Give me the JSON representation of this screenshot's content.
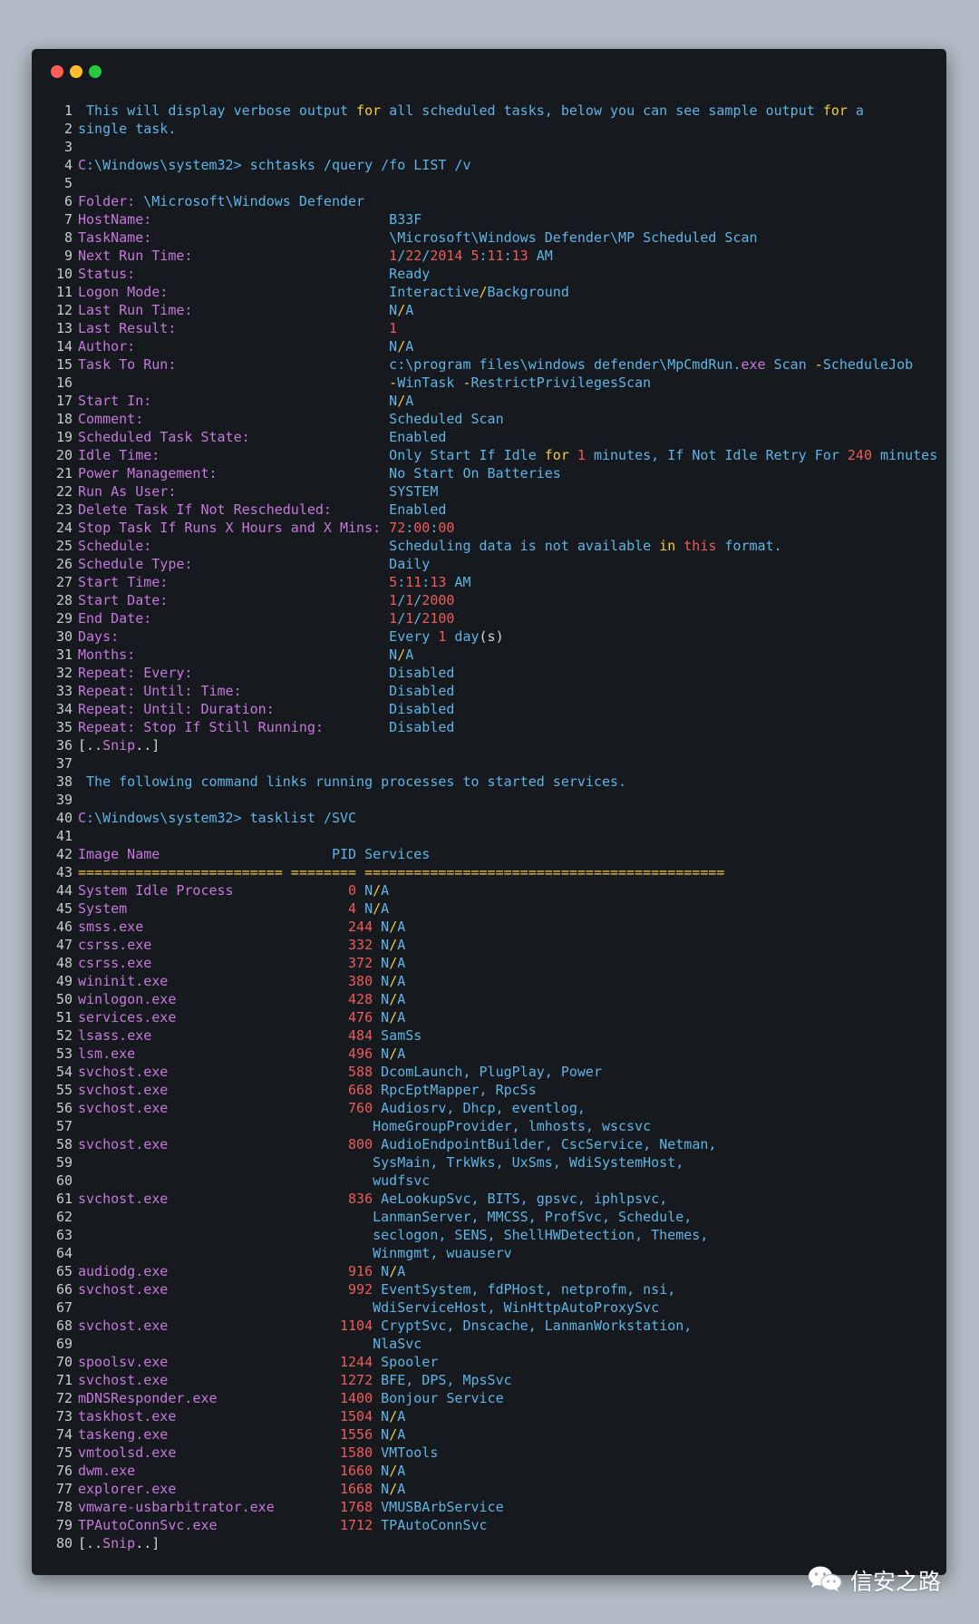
{
  "window": {
    "controls": [
      "close",
      "minimize",
      "maximize"
    ]
  },
  "colors": {
    "cyan": "#5fb4e6",
    "magenta": "#c678dd",
    "red": "#ef5b5b",
    "yellow": "#f7ca3b",
    "white": "#d3d6da",
    "orange": "#e8a33d",
    "background": "#16191d"
  },
  "lines": [
    [
      [
        " This will display verbose output ",
        "cy"
      ],
      [
        "for",
        "yl"
      ],
      [
        " all scheduled tasks, below you can see sample output ",
        "cy"
      ],
      [
        "for",
        "yl"
      ],
      [
        " a",
        "cy"
      ]
    ],
    [
      [
        "single task.",
        "cy"
      ]
    ],
    [],
    [
      [
        "C",
        "mg"
      ],
      [
        ":\\Windows\\system32> schtasks /query /fo LIST /v",
        "cy"
      ]
    ],
    [],
    [
      [
        "Folder: ",
        "mg"
      ],
      [
        "\\Microsoft\\Windows Defender",
        "cy"
      ]
    ],
    [
      [
        "HostName:                             ",
        "mg"
      ],
      [
        "B33F",
        "cy"
      ]
    ],
    [
      [
        "TaskName:                             ",
        "mg"
      ],
      [
        "\\Microsoft\\Windows Defender\\MP Scheduled Scan",
        "cy"
      ]
    ],
    [
      [
        "Next Run Time:                        ",
        "mg"
      ],
      [
        "1",
        "rd"
      ],
      [
        "/",
        "cy"
      ],
      [
        "22",
        "rd"
      ],
      [
        "/",
        "cy"
      ],
      [
        "2014",
        "rd"
      ],
      [
        " ",
        "cy"
      ],
      [
        "5",
        "rd"
      ],
      [
        ":",
        "cy"
      ],
      [
        "11",
        "rd"
      ],
      [
        ":",
        "cy"
      ],
      [
        "13",
        "rd"
      ],
      [
        " AM",
        "cy"
      ]
    ],
    [
      [
        "Status:                               ",
        "mg"
      ],
      [
        "Ready",
        "cy"
      ]
    ],
    [
      [
        "Logon Mode:                           ",
        "mg"
      ],
      [
        "Interactive",
        "cy"
      ],
      [
        "/",
        "yl"
      ],
      [
        "Background",
        "cy"
      ]
    ],
    [
      [
        "Last Run Time:                        ",
        "mg"
      ],
      [
        "N",
        "cy"
      ],
      [
        "/",
        "yl"
      ],
      [
        "A",
        "cy"
      ]
    ],
    [
      [
        "Last Result:                          ",
        "mg"
      ],
      [
        "1",
        "rd"
      ]
    ],
    [
      [
        "Author:                               ",
        "mg"
      ],
      [
        "N",
        "cy"
      ],
      [
        "/",
        "yl"
      ],
      [
        "A",
        "cy"
      ]
    ],
    [
      [
        "Task To Run:                          ",
        "mg"
      ],
      [
        "c:\\program files\\windows defender\\MpCmdRun.",
        "cy"
      ],
      [
        "exe",
        "mg"
      ],
      [
        " Scan ",
        "cy"
      ],
      [
        "-",
        "yl"
      ],
      [
        "ScheduleJob",
        "cy"
      ]
    ],
    [
      [
        "                                      ",
        "mg"
      ],
      [
        "-",
        "yl"
      ],
      [
        "WinTask ",
        "cy"
      ],
      [
        "-",
        "yl"
      ],
      [
        "RestrictPrivilegesScan",
        "cy"
      ]
    ],
    [
      [
        "Start In:                             ",
        "mg"
      ],
      [
        "N",
        "cy"
      ],
      [
        "/",
        "yl"
      ],
      [
        "A",
        "cy"
      ]
    ],
    [
      [
        "Comment:                              ",
        "mg"
      ],
      [
        "Scheduled Scan",
        "cy"
      ]
    ],
    [
      [
        "Scheduled Task State:                 ",
        "mg"
      ],
      [
        "Enabled",
        "cy"
      ]
    ],
    [
      [
        "Idle Time:                            ",
        "mg"
      ],
      [
        "Only Start If Idle ",
        "cy"
      ],
      [
        "for",
        "yl"
      ],
      [
        " ",
        "cy"
      ],
      [
        "1",
        "rd"
      ],
      [
        " minutes, If Not Idle Retry For ",
        "cy"
      ],
      [
        "240",
        "rd"
      ],
      [
        " minutes",
        "cy"
      ]
    ],
    [
      [
        "Power Management:                     ",
        "mg"
      ],
      [
        "No Start On Batteries",
        "cy"
      ]
    ],
    [
      [
        "Run As User:                          ",
        "mg"
      ],
      [
        "SYSTEM",
        "cy"
      ]
    ],
    [
      [
        "Delete Task If Not Rescheduled:       ",
        "mg"
      ],
      [
        "Enabled",
        "cy"
      ]
    ],
    [
      [
        "Stop Task If Runs X Hours and X Mins: ",
        "mg"
      ],
      [
        "72",
        "rd"
      ],
      [
        ":",
        "cy"
      ],
      [
        "00",
        "rd"
      ],
      [
        ":",
        "cy"
      ],
      [
        "00",
        "rd"
      ]
    ],
    [
      [
        "Schedule:                             ",
        "mg"
      ],
      [
        "Scheduling data is not available ",
        "cy"
      ],
      [
        "in",
        "yl"
      ],
      [
        " ",
        "cy"
      ],
      [
        "this",
        "rd"
      ],
      [
        " format.",
        "cy"
      ]
    ],
    [
      [
        "Schedule Type:                        ",
        "mg"
      ],
      [
        "Daily",
        "cy"
      ]
    ],
    [
      [
        "Start Time:                           ",
        "mg"
      ],
      [
        "5",
        "rd"
      ],
      [
        ":",
        "cy"
      ],
      [
        "11",
        "rd"
      ],
      [
        ":",
        "cy"
      ],
      [
        "13",
        "rd"
      ],
      [
        " AM",
        "cy"
      ]
    ],
    [
      [
        "Start Date:                           ",
        "mg"
      ],
      [
        "1",
        "rd"
      ],
      [
        "/",
        "cy"
      ],
      [
        "1",
        "rd"
      ],
      [
        "/",
        "cy"
      ],
      [
        "2000",
        "rd"
      ]
    ],
    [
      [
        "End Date:                             ",
        "mg"
      ],
      [
        "1",
        "rd"
      ],
      [
        "/",
        "cy"
      ],
      [
        "1",
        "rd"
      ],
      [
        "/",
        "cy"
      ],
      [
        "2100",
        "rd"
      ]
    ],
    [
      [
        "Days:                                 ",
        "mg"
      ],
      [
        "Every ",
        "cy"
      ],
      [
        "1",
        "rd"
      ],
      [
        " day",
        "cy"
      ],
      [
        "(s)",
        "wt"
      ]
    ],
    [
      [
        "Months:                               ",
        "mg"
      ],
      [
        "N",
        "cy"
      ],
      [
        "/",
        "yl"
      ],
      [
        "A",
        "cy"
      ]
    ],
    [
      [
        "Repeat: Every:                        ",
        "mg"
      ],
      [
        "Disabled",
        "cy"
      ]
    ],
    [
      [
        "Repeat: Until: Time:                  ",
        "mg"
      ],
      [
        "Disabled",
        "cy"
      ]
    ],
    [
      [
        "Repeat: Until: Duration:              ",
        "mg"
      ],
      [
        "Disabled",
        "cy"
      ]
    ],
    [
      [
        "Repeat: Stop If Still Running:        ",
        "mg"
      ],
      [
        "Disabled",
        "cy"
      ]
    ],
    [
      [
        "[..",
        "wt"
      ],
      [
        "Snip",
        "mg"
      ],
      [
        "..]",
        "wt"
      ]
    ],
    [],
    [
      [
        " The following command links running processes to started services.",
        "cy"
      ]
    ],
    [],
    [
      [
        "C",
        "mg"
      ],
      [
        ":\\Windows\\system32> tasklist /SVC",
        "cy"
      ]
    ],
    [],
    [
      [
        "Image Name                     ",
        "mg"
      ],
      [
        "PID Services",
        "cy"
      ]
    ],
    [
      [
        "========================= ======== ============================================",
        "yl"
      ]
    ],
    [
      [
        "System Idle Process              ",
        "mg"
      ],
      [
        "0",
        "rd"
      ],
      [
        " N",
        "cy"
      ],
      [
        "/",
        "yl"
      ],
      [
        "A",
        "cy"
      ]
    ],
    [
      [
        "System                           ",
        "mg"
      ],
      [
        "4",
        "rd"
      ],
      [
        " N",
        "cy"
      ],
      [
        "/",
        "yl"
      ],
      [
        "A",
        "cy"
      ]
    ],
    [
      [
        "smss.",
        "mg"
      ],
      [
        "exe",
        "mg"
      ],
      [
        "                         ",
        "mg"
      ],
      [
        "244",
        "rd"
      ],
      [
        " N",
        "cy"
      ],
      [
        "/",
        "yl"
      ],
      [
        "A",
        "cy"
      ]
    ],
    [
      [
        "csrss.",
        "mg"
      ],
      [
        "exe",
        "mg"
      ],
      [
        "                        ",
        "mg"
      ],
      [
        "332",
        "rd"
      ],
      [
        " N",
        "cy"
      ],
      [
        "/",
        "yl"
      ],
      [
        "A",
        "cy"
      ]
    ],
    [
      [
        "csrss.",
        "mg"
      ],
      [
        "exe",
        "mg"
      ],
      [
        "                        ",
        "mg"
      ],
      [
        "372",
        "rd"
      ],
      [
        " N",
        "cy"
      ],
      [
        "/",
        "yl"
      ],
      [
        "A",
        "cy"
      ]
    ],
    [
      [
        "wininit.",
        "mg"
      ],
      [
        "exe",
        "mg"
      ],
      [
        "                      ",
        "mg"
      ],
      [
        "380",
        "rd"
      ],
      [
        " N",
        "cy"
      ],
      [
        "/",
        "yl"
      ],
      [
        "A",
        "cy"
      ]
    ],
    [
      [
        "winlogon.",
        "mg"
      ],
      [
        "exe",
        "mg"
      ],
      [
        "                     ",
        "mg"
      ],
      [
        "428",
        "rd"
      ],
      [
        " N",
        "cy"
      ],
      [
        "/",
        "yl"
      ],
      [
        "A",
        "cy"
      ]
    ],
    [
      [
        "services.",
        "mg"
      ],
      [
        "exe",
        "mg"
      ],
      [
        "                     ",
        "mg"
      ],
      [
        "476",
        "rd"
      ],
      [
        " N",
        "cy"
      ],
      [
        "/",
        "yl"
      ],
      [
        "A",
        "cy"
      ]
    ],
    [
      [
        "lsass.",
        "mg"
      ],
      [
        "exe",
        "mg"
      ],
      [
        "                        ",
        "mg"
      ],
      [
        "484",
        "rd"
      ],
      [
        " SamSs",
        "cy"
      ]
    ],
    [
      [
        "lsm.",
        "mg"
      ],
      [
        "exe",
        "mg"
      ],
      [
        "                          ",
        "mg"
      ],
      [
        "496",
        "rd"
      ],
      [
        " N",
        "cy"
      ],
      [
        "/",
        "yl"
      ],
      [
        "A",
        "cy"
      ]
    ],
    [
      [
        "svchost.",
        "mg"
      ],
      [
        "exe",
        "mg"
      ],
      [
        "                      ",
        "mg"
      ],
      [
        "588",
        "rd"
      ],
      [
        " DcomLaunch, PlugPlay, Power",
        "cy"
      ]
    ],
    [
      [
        "svchost.",
        "mg"
      ],
      [
        "exe",
        "mg"
      ],
      [
        "                      ",
        "mg"
      ],
      [
        "668",
        "rd"
      ],
      [
        " RpcEptMapper, RpcSs",
        "cy"
      ]
    ],
    [
      [
        "svchost.",
        "mg"
      ],
      [
        "exe",
        "mg"
      ],
      [
        "                      ",
        "mg"
      ],
      [
        "760",
        "rd"
      ],
      [
        " Audiosrv, Dhcp, eventlog,",
        "cy"
      ]
    ],
    [
      [
        "                                    HomeGroupProvider, lmhosts, wscsvc",
        "cy"
      ]
    ],
    [
      [
        "svchost.",
        "mg"
      ],
      [
        "exe",
        "mg"
      ],
      [
        "                      ",
        "mg"
      ],
      [
        "800",
        "rd"
      ],
      [
        " AudioEndpointBuilder, CscService, Netman,",
        "cy"
      ]
    ],
    [
      [
        "                                    SysMain, TrkWks, UxSms, WdiSystemHost,",
        "cy"
      ]
    ],
    [
      [
        "                                    wudfsvc",
        "cy"
      ]
    ],
    [
      [
        "svchost.",
        "mg"
      ],
      [
        "exe",
        "mg"
      ],
      [
        "                      ",
        "mg"
      ],
      [
        "836",
        "rd"
      ],
      [
        " AeLookupSvc, BITS, gpsvc, iphlpsvc,",
        "cy"
      ]
    ],
    [
      [
        "                                    LanmanServer, MMCSS, ProfSvc, Schedule,",
        "cy"
      ]
    ],
    [
      [
        "                                    seclogon, SENS, ShellHWDetection, Themes,",
        "cy"
      ]
    ],
    [
      [
        "                                    Winmgmt, wuauserv",
        "cy"
      ]
    ],
    [
      [
        "audiodg.",
        "mg"
      ],
      [
        "exe",
        "mg"
      ],
      [
        "                      ",
        "mg"
      ],
      [
        "916",
        "rd"
      ],
      [
        " N",
        "cy"
      ],
      [
        "/",
        "yl"
      ],
      [
        "A",
        "cy"
      ]
    ],
    [
      [
        "svchost.",
        "mg"
      ],
      [
        "exe",
        "mg"
      ],
      [
        "                      ",
        "mg"
      ],
      [
        "992",
        "rd"
      ],
      [
        " EventSystem, fdPHost, netprofm, nsi,",
        "cy"
      ]
    ],
    [
      [
        "                                    WdiServiceHost, WinHttpAutoProxySvc",
        "cy"
      ]
    ],
    [
      [
        "svchost.",
        "mg"
      ],
      [
        "exe",
        "mg"
      ],
      [
        "                     ",
        "mg"
      ],
      [
        "1104",
        "rd"
      ],
      [
        " CryptSvc, Dnscache, LanmanWorkstation,",
        "cy"
      ]
    ],
    [
      [
        "                                    NlaSvc",
        "cy"
      ]
    ],
    [
      [
        "spoolsv.",
        "mg"
      ],
      [
        "exe",
        "mg"
      ],
      [
        "                     ",
        "mg"
      ],
      [
        "1244",
        "rd"
      ],
      [
        " Spooler",
        "cy"
      ]
    ],
    [
      [
        "svchost.",
        "mg"
      ],
      [
        "exe",
        "mg"
      ],
      [
        "                     ",
        "mg"
      ],
      [
        "1272",
        "rd"
      ],
      [
        " BFE, DPS, MpsSvc",
        "cy"
      ]
    ],
    [
      [
        "mDNSResponder.",
        "mg"
      ],
      [
        "exe",
        "mg"
      ],
      [
        "               ",
        "mg"
      ],
      [
        "1400",
        "rd"
      ],
      [
        " Bonjour Service",
        "cy"
      ]
    ],
    [
      [
        "taskhost.",
        "mg"
      ],
      [
        "exe",
        "mg"
      ],
      [
        "                    ",
        "mg"
      ],
      [
        "1504",
        "rd"
      ],
      [
        " N",
        "cy"
      ],
      [
        "/",
        "yl"
      ],
      [
        "A",
        "cy"
      ]
    ],
    [
      [
        "taskeng.",
        "mg"
      ],
      [
        "exe",
        "mg"
      ],
      [
        "                     ",
        "mg"
      ],
      [
        "1556",
        "rd"
      ],
      [
        " N",
        "cy"
      ],
      [
        "/",
        "yl"
      ],
      [
        "A",
        "cy"
      ]
    ],
    [
      [
        "vmtoolsd.",
        "mg"
      ],
      [
        "exe",
        "mg"
      ],
      [
        "                    ",
        "mg"
      ],
      [
        "1580",
        "rd"
      ],
      [
        " VMTools",
        "cy"
      ]
    ],
    [
      [
        "dwm.",
        "mg"
      ],
      [
        "exe",
        "mg"
      ],
      [
        "                         ",
        "mg"
      ],
      [
        "1660",
        "rd"
      ],
      [
        " N",
        "cy"
      ],
      [
        "/",
        "yl"
      ],
      [
        "A",
        "cy"
      ]
    ],
    [
      [
        "explorer.",
        "mg"
      ],
      [
        "exe",
        "mg"
      ],
      [
        "                    ",
        "mg"
      ],
      [
        "1668",
        "rd"
      ],
      [
        " N",
        "cy"
      ],
      [
        "/",
        "yl"
      ],
      [
        "A",
        "cy"
      ]
    ],
    [
      [
        "vmware-usbarbitrator.",
        "mg"
      ],
      [
        "exe",
        "mg"
      ],
      [
        "        ",
        "mg"
      ],
      [
        "1768",
        "rd"
      ],
      [
        " VMUSBArbService",
        "cy"
      ]
    ],
    [
      [
        "TPAutoConnSvc.",
        "mg"
      ],
      [
        "exe",
        "mg"
      ],
      [
        "               ",
        "mg"
      ],
      [
        "1712",
        "rd"
      ],
      [
        " TPAutoConnSvc",
        "cy"
      ]
    ],
    [
      [
        "[..",
        "wt"
      ],
      [
        "Snip",
        "mg"
      ],
      [
        "..]",
        "wt"
      ]
    ]
  ],
  "watermark": {
    "icon": "wechat-icon",
    "text": "信安之路"
  }
}
